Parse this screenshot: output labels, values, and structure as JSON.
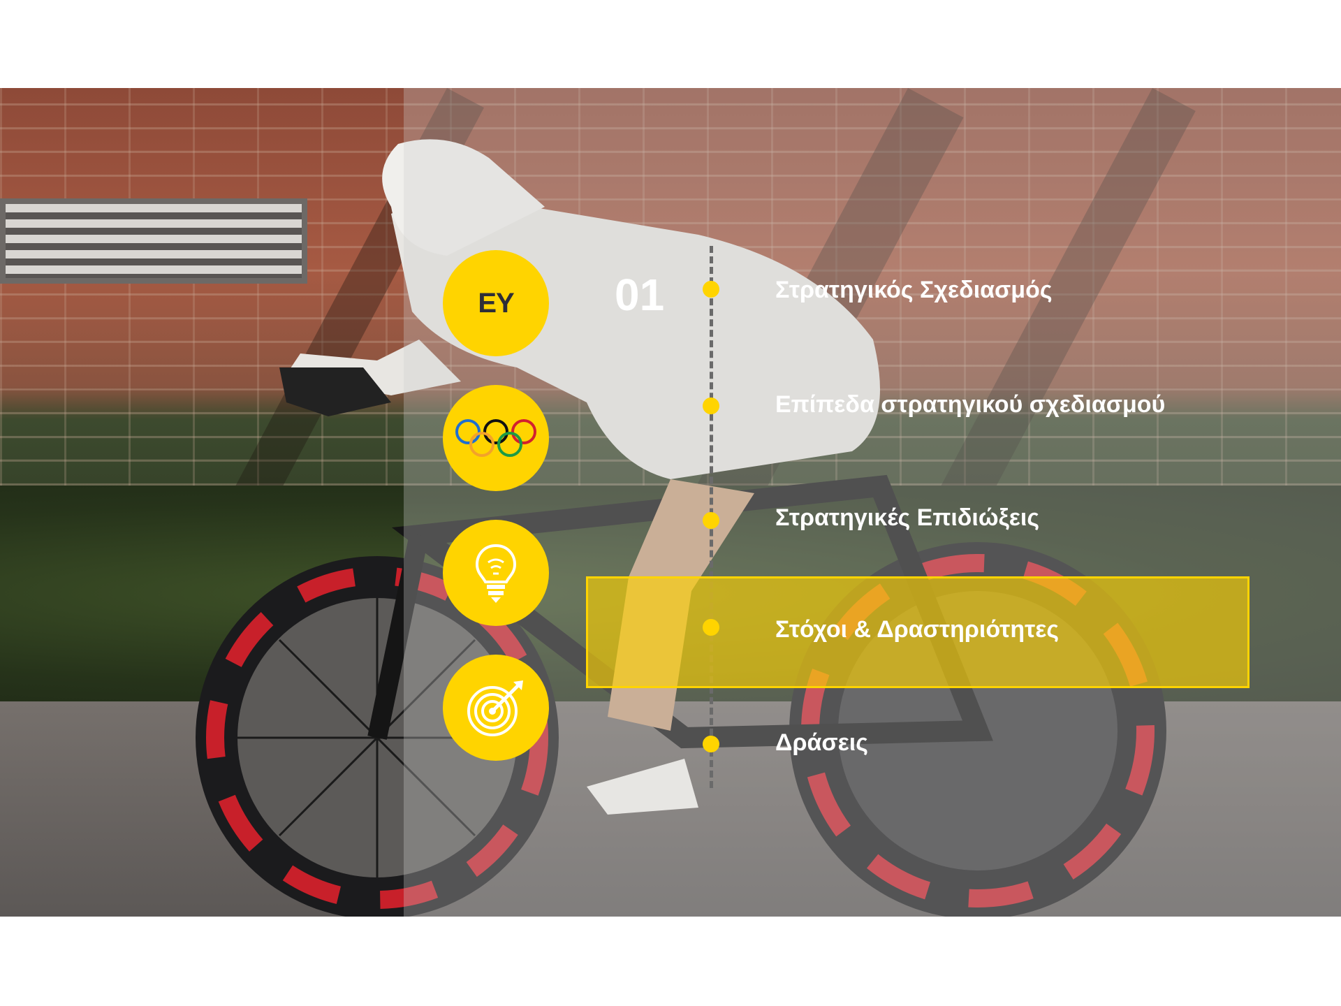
{
  "logo": {
    "text": "EY"
  },
  "section_number": "01",
  "menu": {
    "items": [
      {
        "label": "Στρατηγικός Σχεδιασμός",
        "active": false
      },
      {
        "label": "Επίπεδα στρατηγικού σχεδιασμού",
        "active": false
      },
      {
        "label": "Στρατηγικές Επιδιώξεις",
        "active": false
      },
      {
        "label": "Στόχοι & Δραστηριότητες",
        "active": true
      },
      {
        "label": "Δράσεις",
        "active": false
      }
    ]
  },
  "icons": [
    "ey-logo",
    "olympic-rings-icon",
    "lightbulb-icon",
    "target-icon"
  ],
  "colors": {
    "accent": "#ffd400",
    "label": "#ffffff",
    "timeline": "#6a6a6a"
  }
}
